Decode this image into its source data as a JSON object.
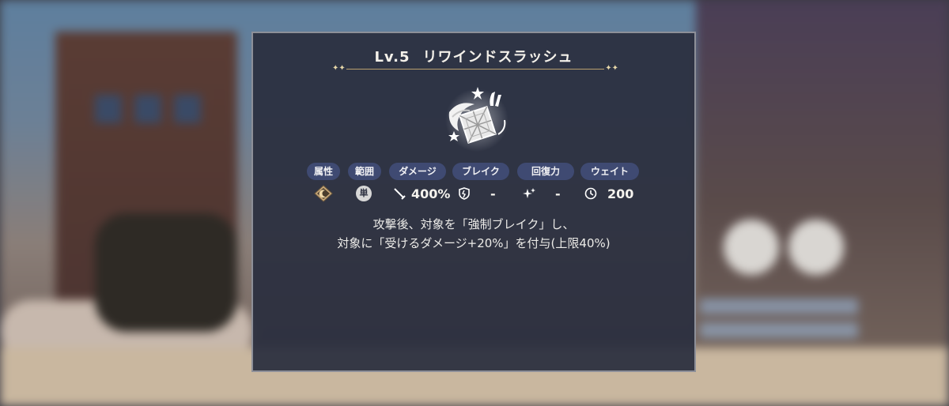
{
  "skill": {
    "level": "Lv.5",
    "name": "リワインドスラッシュ",
    "icon": "sword-cube-icon"
  },
  "stats": {
    "labels": [
      "属性",
      "範囲",
      "ダメージ",
      "ブレイク",
      "回復力",
      "ウェイト"
    ],
    "attribute_icon": "moon-attribute-icon",
    "range_icon": "single-target-icon",
    "range_glyph": "単",
    "damage": "400%",
    "break": "-",
    "heal": "-",
    "wait": "200"
  },
  "description": {
    "line1": "攻撃後、対象を「強制ブレイク」し、",
    "line2": "対象に「受けるダメージ+20%」を付与(上限40%)"
  },
  "colors": {
    "panel": "#2a2e3e",
    "tag": "#3f4a72",
    "accent_gold": "#b9a06f"
  }
}
